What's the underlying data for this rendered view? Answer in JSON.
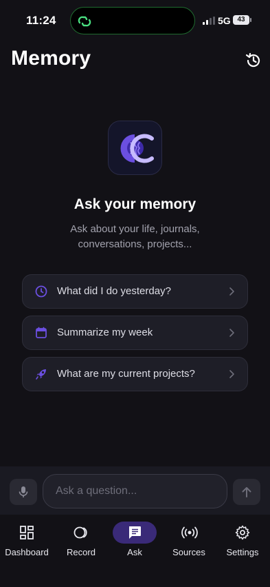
{
  "status_bar": {
    "time": "11:24",
    "network": "5G",
    "battery": "43"
  },
  "header": {
    "title": "Memory",
    "history_icon": "history-icon"
  },
  "hero": {
    "title": "Ask your memory",
    "subtitle": "Ask about your life, journals, conversations, projects..."
  },
  "suggestions": [
    {
      "label": "What did I do yesterday?",
      "icon": "clock-icon"
    },
    {
      "label": "Summarize my week",
      "icon": "calendar-icon"
    },
    {
      "label": "What are my current projects?",
      "icon": "rocket-icon"
    }
  ],
  "input": {
    "placeholder": "Ask a question...",
    "value": ""
  },
  "tabs": [
    {
      "label": "Dashboard",
      "icon": "dashboard-icon",
      "active": false
    },
    {
      "label": "Record",
      "icon": "record-icon",
      "active": false
    },
    {
      "label": "Ask",
      "icon": "chat-icon",
      "active": true
    },
    {
      "label": "Sources",
      "icon": "broadcast-icon",
      "active": false
    },
    {
      "label": "Settings",
      "icon": "gear-icon",
      "active": false
    }
  ],
  "colors": {
    "background": "#121116",
    "accent": "#6b4fe0",
    "active_tab": "#3a2a78",
    "island_accent": "#4ade80"
  }
}
